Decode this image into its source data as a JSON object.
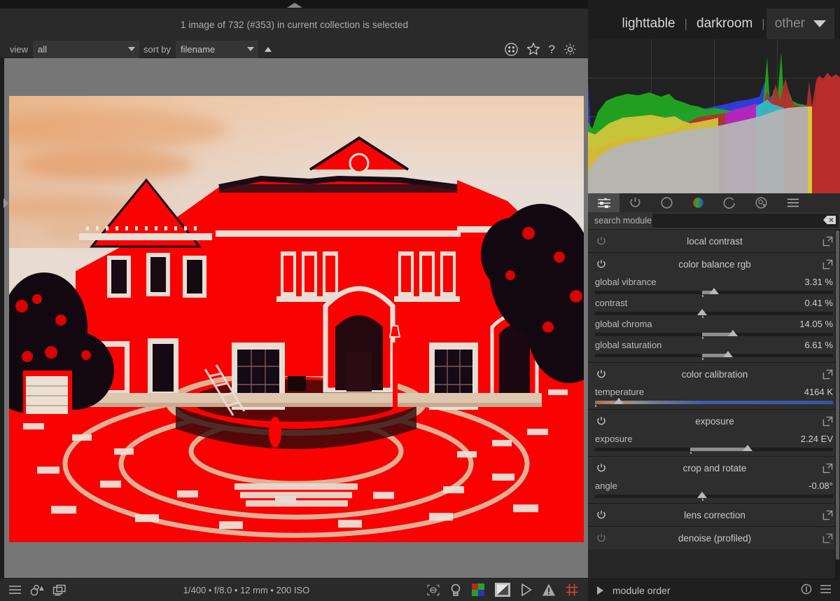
{
  "header": {
    "selection_status": "1 image of 732 (#353) in current collection is selected",
    "views": [
      {
        "label": "lighttable",
        "active": true
      },
      {
        "label": "darkroom",
        "active": true
      },
      {
        "label": "other",
        "active": false
      }
    ],
    "separator": "|"
  },
  "filter_bar": {
    "view_label": "view",
    "view_value": "all",
    "sort_label": "sort by",
    "sort_value": "filename",
    "sort_direction": "ascending",
    "icons": [
      "grid-icon",
      "star-icon",
      "help-icon",
      "gear-icon"
    ]
  },
  "image": {
    "overexposed_overlay_color": "#fb0202",
    "sky_color": "#e8d5c5"
  },
  "bottom_bar": {
    "exif": "1/400 • f/8.0 • 12 mm • 200 ISO",
    "left_icons": [
      "hamburger-icon",
      "grouping-icon",
      "overlays-icon"
    ],
    "right_icons": [
      "softproof-icon",
      "gamut-check-icon",
      "color-assessment-icon",
      "iso12646-icon",
      "focus-peaking-icon",
      "overexposed-icon",
      "raw-overexposed-icon"
    ]
  },
  "right_panel": {
    "tabs": [
      {
        "name": "active-modules-tab",
        "icon": "sliders-icon",
        "active": true
      },
      {
        "name": "favorite-modules-tab",
        "icon": "power-icon",
        "active": false
      },
      {
        "name": "tone-group-tab",
        "icon": "circle-icon",
        "active": false
      },
      {
        "name": "color-group-tab",
        "icon": "color-circle-icon",
        "active": false
      },
      {
        "name": "correction-group-tab",
        "icon": "arc-icon",
        "active": false
      },
      {
        "name": "effects-group-tab",
        "icon": "effects-icon",
        "active": false
      },
      {
        "name": "module-presets-menu",
        "icon": "hamburger-icon",
        "active": false
      }
    ],
    "search": {
      "label": "search module",
      "value": "",
      "placeholder": "",
      "clear_icon": "backspace-icon"
    },
    "modules": [
      {
        "name": "local contrast",
        "enabled": false,
        "power_icon": "power-icon",
        "expand_icon": "multi-instance-icon",
        "params": []
      },
      {
        "name": "color balance rgb",
        "enabled": true,
        "power_icon": "power-icon",
        "expand_icon": "multi-instance-icon",
        "params": [
          {
            "label": "global vibrance",
            "value": "3.31 %",
            "fill_start": 45,
            "fill_end": 50,
            "knob": 50,
            "marker": 45
          },
          {
            "label": "contrast",
            "value": "0.41 %",
            "fill_start": 45,
            "fill_end": 45,
            "knob": 45,
            "marker": 45
          },
          {
            "label": "global chroma",
            "value": "14.05 %",
            "fill_start": 45,
            "fill_end": 58,
            "knob": 58,
            "marker": 45
          },
          {
            "label": "global saturation",
            "value": "6.61 %",
            "fill_start": 45,
            "fill_end": 56,
            "knob": 56,
            "marker": 45
          }
        ]
      },
      {
        "name": "color calibration",
        "enabled": true,
        "power_icon": "power-icon",
        "expand_icon": "multi-instance-icon",
        "params": [
          {
            "label": "temperature",
            "value": "4164 K",
            "fill_start": 0,
            "fill_end": 0,
            "knob": 10,
            "marker": 0,
            "gradient": "temperature"
          }
        ]
      },
      {
        "name": "exposure",
        "enabled": true,
        "power_icon": "power-icon",
        "expand_icon": "multi-instance-icon",
        "params": [
          {
            "label": "exposure",
            "value": "2.24 EV",
            "fill_start": 40,
            "fill_end": 64,
            "knob": 64,
            "marker": 40
          }
        ]
      },
      {
        "name": "crop and rotate",
        "enabled": true,
        "power_icon": "power-icon",
        "expand_icon": "multi-instance-icon",
        "params": [
          {
            "label": "angle",
            "value": "-0.08°",
            "fill_start": 45,
            "fill_end": 45,
            "knob": 45,
            "marker": 45
          }
        ]
      },
      {
        "name": "lens correction",
        "enabled": true,
        "power_icon": "power-icon",
        "expand_icon": "multi-instance-icon",
        "params": []
      },
      {
        "name": "denoise (profiled)",
        "enabled": false,
        "power_icon": "power-icon",
        "expand_icon": "multi-instance-icon",
        "params": []
      }
    ],
    "module_order": {
      "label": "module order",
      "expand_icon": "triangle-right-icon",
      "icons": [
        "reset-icon",
        "presets-menu-icon"
      ]
    }
  },
  "chart_data": {
    "type": "area",
    "title": "RGB histogram",
    "xlabel": "",
    "ylabel": "",
    "grid": true,
    "channels": [
      "red",
      "green",
      "blue",
      "gray"
    ],
    "x": [
      0,
      10,
      20,
      30,
      40,
      50,
      60,
      70,
      80,
      90,
      100
    ],
    "series": [
      {
        "name": "red",
        "values": [
          5,
          42,
          46,
          44,
          48,
          52,
          54,
          60,
          72,
          96,
          80
        ]
      },
      {
        "name": "green",
        "values": [
          12,
          62,
          64,
          62,
          52,
          50,
          50,
          52,
          64,
          88,
          6
        ]
      },
      {
        "name": "blue",
        "values": [
          18,
          40,
          38,
          38,
          42,
          48,
          56,
          58,
          62,
          70,
          4
        ]
      },
      {
        "name": "luminance",
        "values": [
          8,
          40,
          44,
          44,
          46,
          48,
          50,
          52,
          58,
          62,
          2
        ]
      }
    ]
  }
}
